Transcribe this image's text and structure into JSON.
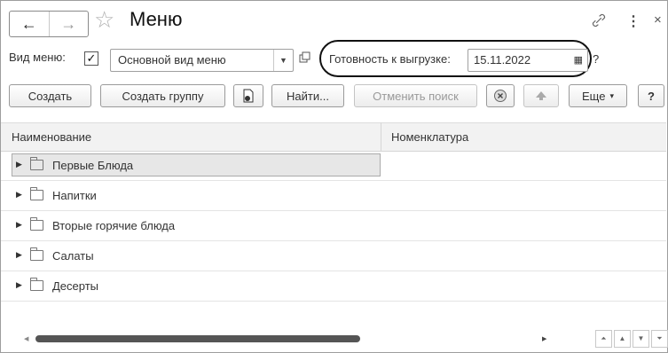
{
  "window": {
    "title": "Меню",
    "back_icon": "←",
    "forward_icon": "→",
    "star_icon": "☆",
    "link_icon": "🔗",
    "more_icon": "⋮",
    "close_icon": "×"
  },
  "filters": {
    "menu_type_label": "Вид меню:",
    "menu_type_checked": "✓",
    "menu_type_value": "Основной вид меню",
    "ready_label": "Готовность к выгрузке:",
    "ready_date": "15.11.2022",
    "help": "?"
  },
  "toolbar": {
    "create": "Создать",
    "create_group": "Создать группу",
    "find": "Найти...",
    "cancel_search": "Отменить поиск",
    "more": "Еще",
    "help": "?"
  },
  "table": {
    "columns": [
      "Наименование",
      "Номенклатура"
    ],
    "rows": [
      {
        "name": "Первые Блюда"
      },
      {
        "name": "Напитки"
      },
      {
        "name": "Вторые горячие блюда"
      },
      {
        "name": "Салаты"
      },
      {
        "name": "Десерты"
      }
    ]
  },
  "colors": {
    "accent": "#111111",
    "selection": "#e7e7e7"
  }
}
